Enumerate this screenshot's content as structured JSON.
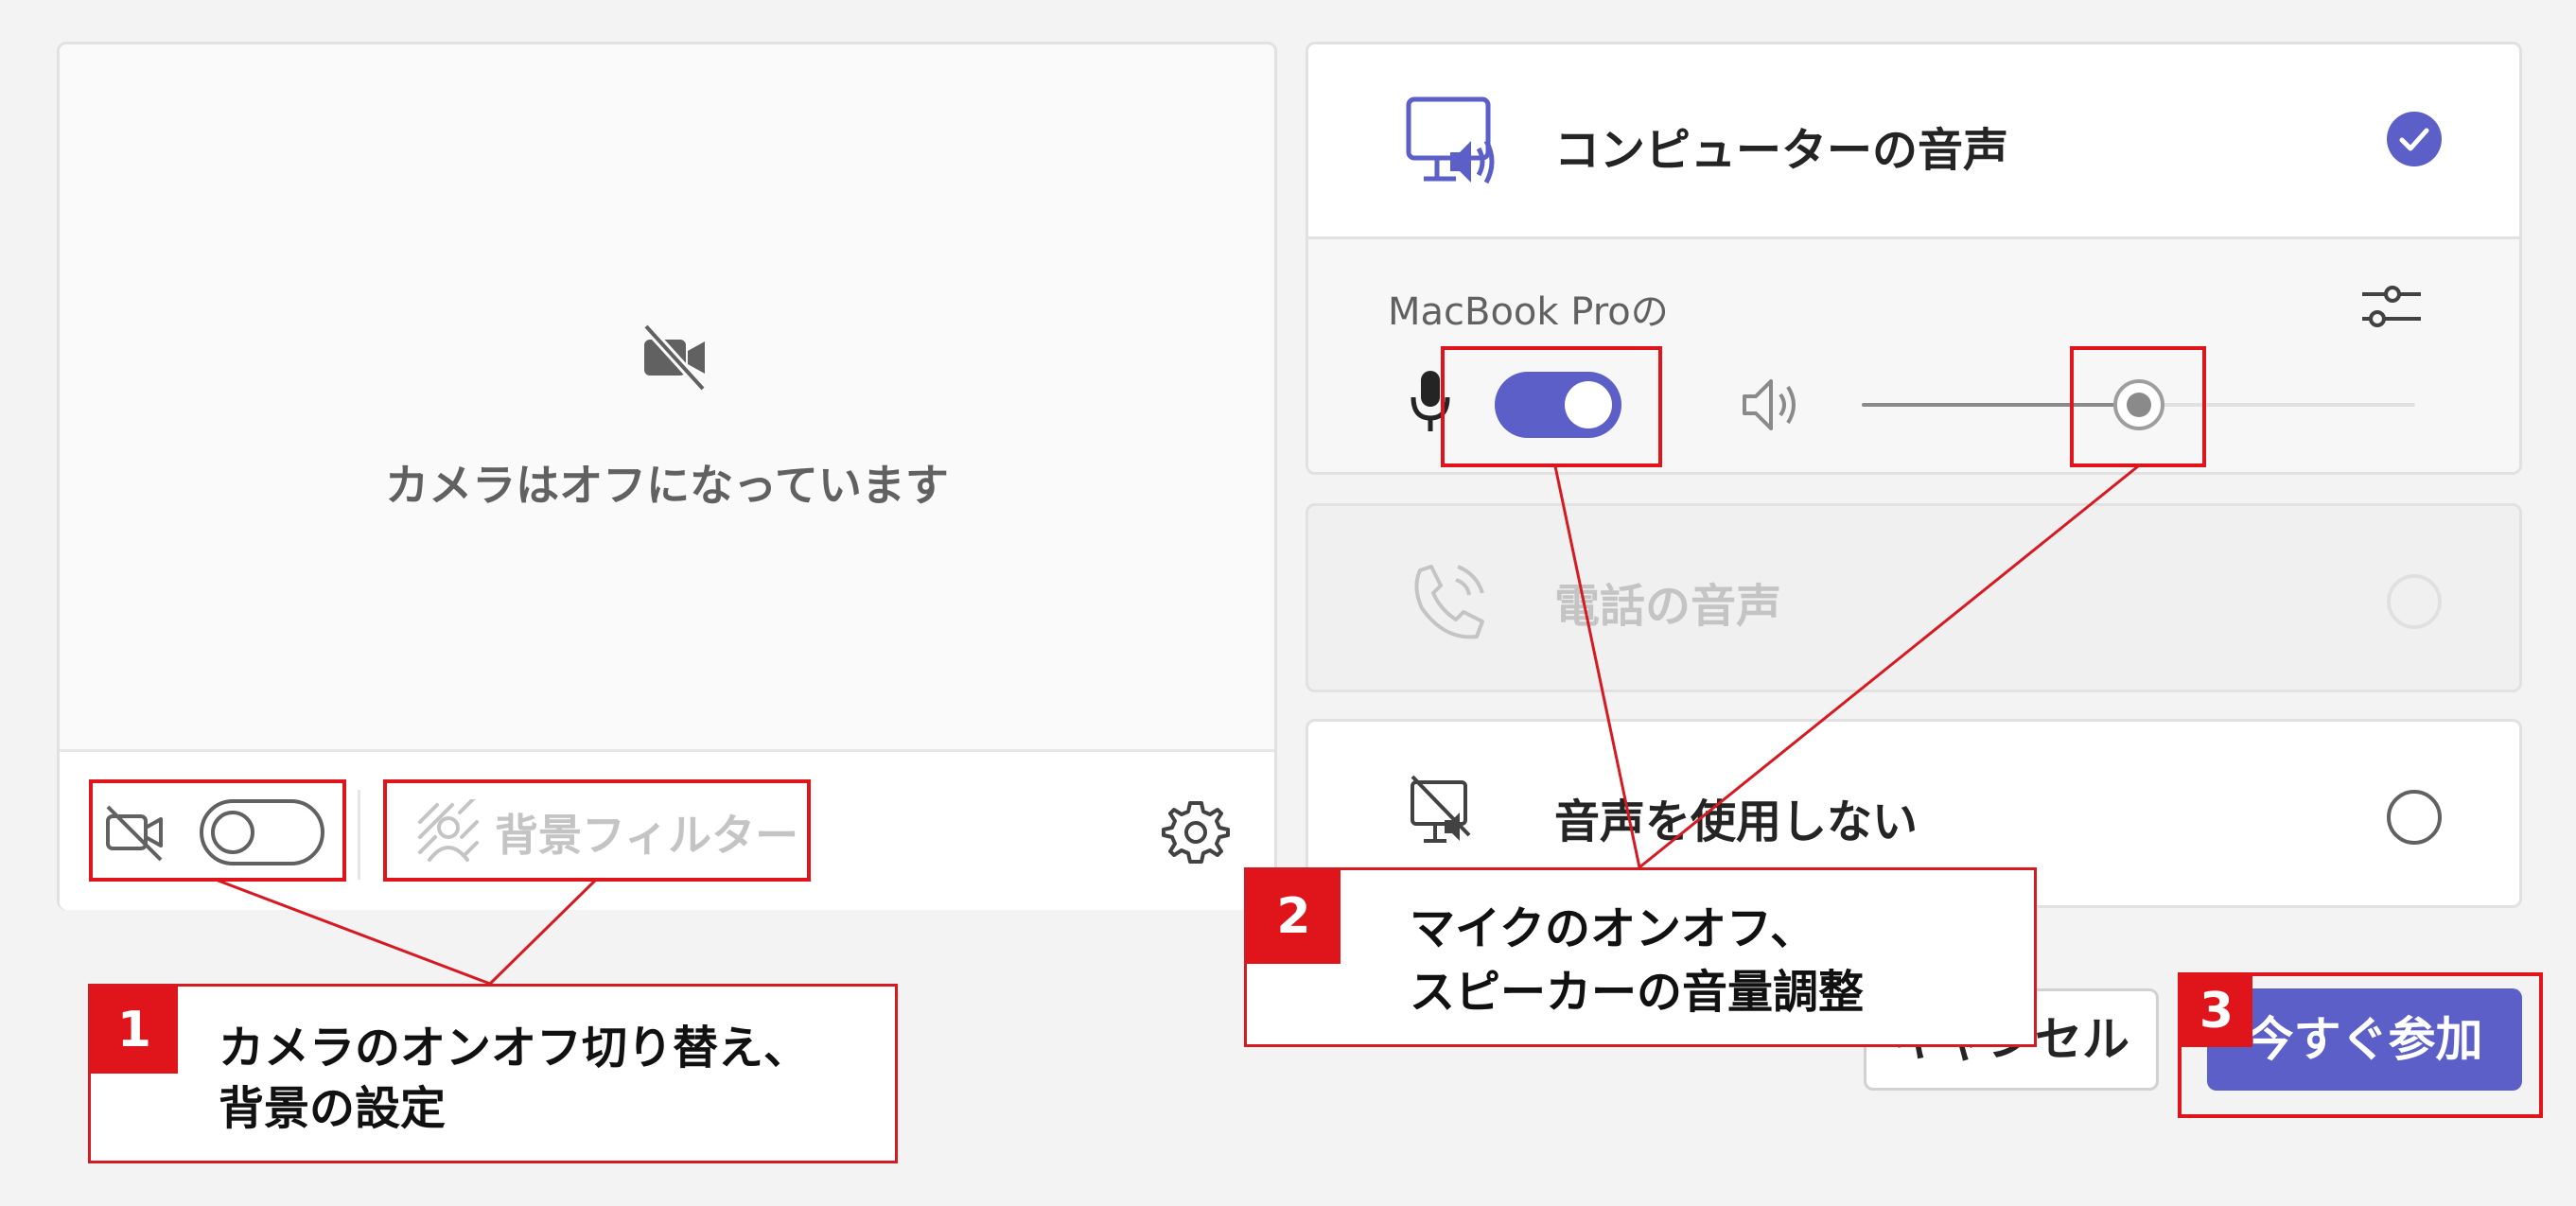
{
  "camera_panel": {
    "status_text": "カメラはオフになっています",
    "background_filter_label": "背景フィルター"
  },
  "audio_options": {
    "computer_audio_label": "コンピューターの音声",
    "device_name": "MacBook Proの",
    "phone_audio_label": "電話の音声",
    "no_audio_label": "音声を使用しない",
    "mic_enabled": true,
    "speaker_volume": 0.5
  },
  "actions": {
    "cancel_label": "キャンセル",
    "join_label": "今すぐ参加"
  },
  "annotations": [
    {
      "number": "1",
      "text_line1": "カメラのオンオフ切り替え、",
      "text_line2": "背景の設定"
    },
    {
      "number": "2",
      "text_line1": "マイクのオンオフ、",
      "text_line2": "スピーカーの音量調整"
    },
    {
      "number": "3"
    }
  ],
  "colors": {
    "accent": "#5b5fc7",
    "annotation_red": "#e0141b"
  }
}
